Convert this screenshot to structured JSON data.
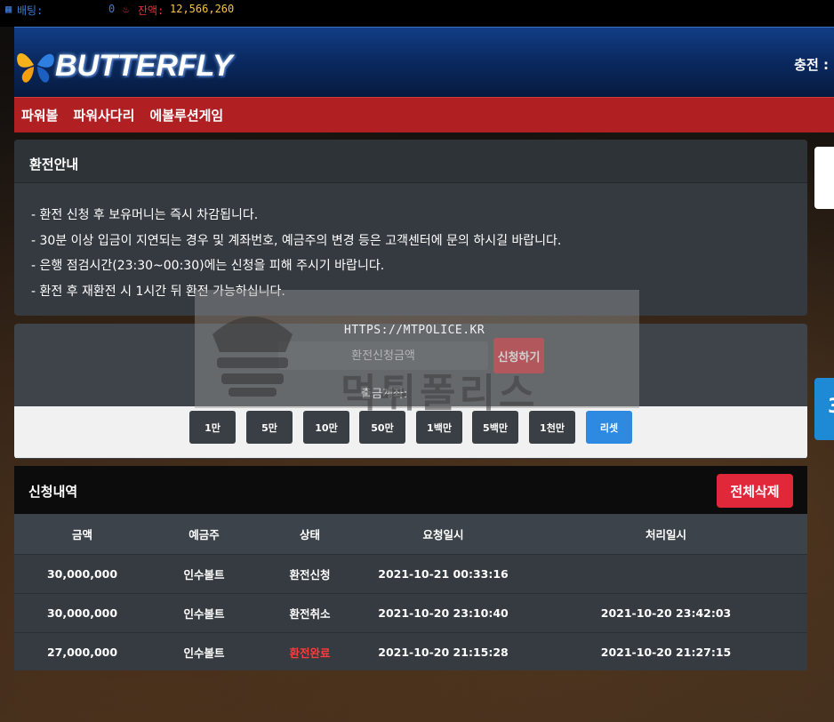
{
  "top_strip": {
    "bet_label": "배팅:",
    "bet_value": "0",
    "balance_label": "잔액:",
    "balance_value": "12,566,260"
  },
  "header": {
    "logo_text": "BUTTERFLY",
    "right_text": "충전 : "
  },
  "nav": {
    "items": [
      "파워볼",
      "파워사다리",
      "에볼루션게임"
    ]
  },
  "info_panel": {
    "title": "환전안내",
    "lines": [
      "- 환전 신청 후 보유머니는 즉시 차감됩니다.",
      "- 30분 이상 입금이 지연되는 경우 및 계좌번호, 예금주의 변경 등은 고객센터에 문의 하시길 바랍니다.",
      "- 은행 점검시간(23:30~00:30)에는 신청을 피해 주시기 바랍니다.",
      "- 환전 후 재환전 시 1시간 뒤 환전 가능하십니다."
    ]
  },
  "form": {
    "amount_placeholder": "환전신청금액",
    "apply_label": "신청하기",
    "account_label": "출금계좌:",
    "quick_buttons": [
      "1만",
      "5만",
      "10만",
      "50만",
      "1백만",
      "5백만",
      "1천만"
    ],
    "reset_label": "리셋"
  },
  "history": {
    "title": "신청내역",
    "delete_all_label": "전체삭제",
    "columns": [
      "금액",
      "예금주",
      "상태",
      "요청일시",
      "처리일시"
    ],
    "rows": [
      {
        "amount": "30,000,000",
        "holder": "인수볼트",
        "status": "환전신청",
        "requested": "2021-10-21 00:33:16",
        "processed": ""
      },
      {
        "amount": "30,000,000",
        "holder": "인수볼트",
        "status": "환전취소",
        "requested": "2021-10-20 23:10:40",
        "processed": "2021-10-20 23:42:03"
      },
      {
        "amount": "27,000,000",
        "holder": "인수볼트",
        "status": "환전완료",
        "requested": "2021-10-20 21:15:28",
        "processed": "2021-10-20 21:27:15"
      }
    ]
  },
  "watermark": {
    "url": "HTTPS://MTPOLICE.KR",
    "text": "먹튀폴리스"
  },
  "colors": {
    "nav_red": "#b01f22",
    "status_done_red": "#ff3b3b",
    "reset_blue": "#2d8ae0",
    "delete_red": "#e0283a"
  }
}
